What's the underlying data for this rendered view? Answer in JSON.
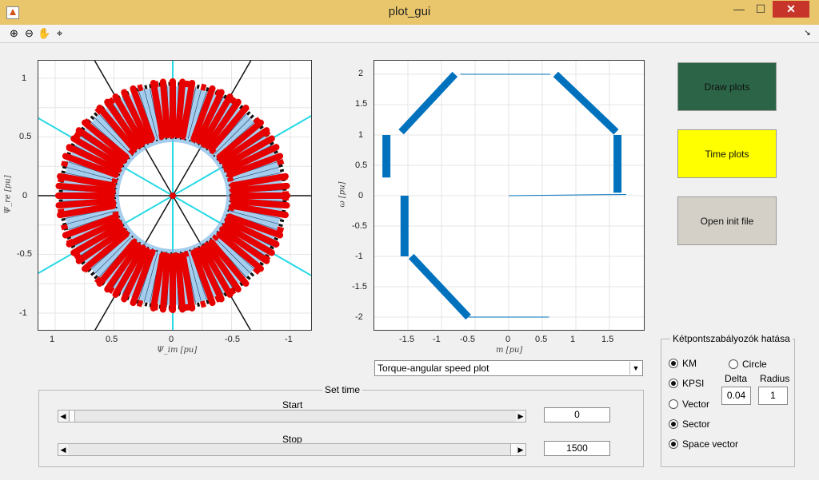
{
  "window": {
    "title": "plot_gui",
    "minimize": "—",
    "maximize": "☐",
    "close": "✕"
  },
  "toolbar": {
    "tools": [
      {
        "icon": "zoom-in-icon",
        "glyph": "⊕"
      },
      {
        "icon": "zoom-out-icon",
        "glyph": "⊖"
      },
      {
        "icon": "pan-hand-icon",
        "glyph": "✋"
      },
      {
        "icon": "data-cursor-icon",
        "glyph": "⌖"
      }
    ]
  },
  "plot1": {
    "xlabel": "Ψ_im [pu]",
    "ylabel": "Ψ_re [pu]",
    "xticks": [
      "1",
      "0.5",
      "0",
      "-0.5",
      "-1"
    ],
    "yticks": [
      "1",
      "0.5",
      "0",
      "-0.5",
      "-1"
    ]
  },
  "plot2": {
    "xlabel": "m [pu]",
    "ylabel": "ω [pu]",
    "xticks": [
      "-1.5",
      "-1",
      "-0.5",
      "0",
      "0.5",
      "1",
      "1.5"
    ],
    "yticks": [
      "2",
      "1.5",
      "1",
      "0.5",
      "0",
      "-0.5",
      "-1",
      "-1.5",
      "-2"
    ]
  },
  "buttons": {
    "draw": "Draw plots",
    "time": "Time plots",
    "open": "Open init file"
  },
  "colors": {
    "draw_bg": "#2b6446",
    "time_bg": "#ffff00",
    "open_bg": "#d4d0c8",
    "trace_red": "#e60000",
    "trace_blue": "#0072bd",
    "grid_cyan": "#26d9e6"
  },
  "plot_select": {
    "value": "Torque-angular speed plot"
  },
  "set_time": {
    "title": "Set time",
    "start_label": "Start",
    "stop_label": "Stop",
    "start_value": "0",
    "stop_value": "1500",
    "start_fraction": 0.0,
    "stop_fraction": 1.0
  },
  "settings": {
    "title": "Kétpontszabályozók hatása",
    "options": [
      {
        "label": "KM",
        "checked": true
      },
      {
        "label": "KPSI",
        "checked": true
      },
      {
        "label": "Vector",
        "checked": false
      },
      {
        "label": "Sector",
        "checked": true
      },
      {
        "label": "Space vector",
        "checked": true
      },
      {
        "label": "Circle",
        "checked": false
      }
    ],
    "delta_label": "Delta",
    "delta_value": "0.04",
    "radius_label": "Radius",
    "radius_value": "1"
  }
}
